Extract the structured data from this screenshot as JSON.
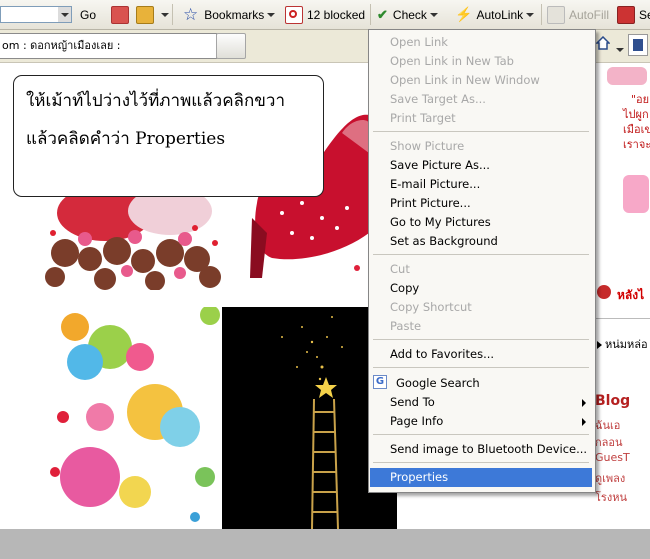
{
  "toolbar": {
    "go_label": "Go",
    "bookmarks_label": "Bookmarks",
    "blocked_label": "12 blocked",
    "check_label": "Check",
    "autolink_label": "AutoLink",
    "autofill_label": "AutoFill",
    "send_label": "Se"
  },
  "address": {
    "page_text": "om : ดอกหญ้าเมืองเลย :"
  },
  "callout": {
    "line1": "ให้เม้าท์ไปว่างไว้ที่ภาพแล้วคลิกขวา",
    "line2": "แล้วคลิดคำว่า Properties"
  },
  "context_menu": {
    "group1": [
      "Open Link",
      "Open Link in New Tab",
      "Open Link in New Window",
      "Save Target As...",
      "Print Target"
    ],
    "group2": [
      "Show Picture",
      "Save Picture As...",
      "E-mail Picture...",
      "Print Picture...",
      "Go to My Pictures",
      "Set as Background"
    ],
    "group3": [
      "Cut",
      "Copy",
      "Copy Shortcut",
      "Paste"
    ],
    "group4": [
      "Add to Favorites..."
    ],
    "group5": [
      "Google Search",
      "Send To",
      "Page Info"
    ],
    "group6": [
      "Send image to Bluetooth Device..."
    ],
    "group7": [
      "Properties"
    ]
  },
  "right_column": {
    "top1": "\"อย",
    "top2": "ไปผูก",
    "top3": "เมือเข",
    "top4": "เราจะ",
    "heart_text": "หลังไ",
    "nav_text": "หน่มหล่อ",
    "blog_title": "Blog",
    "blog1": "ฉันเอ",
    "blog2": "กลอน",
    "blog3": "GuesT",
    "blog4": "ดูเพลง",
    "blog5": "โรงหน"
  },
  "colors": {
    "menu_highlight": "#3d79d8",
    "blog_title": "#b52020"
  }
}
